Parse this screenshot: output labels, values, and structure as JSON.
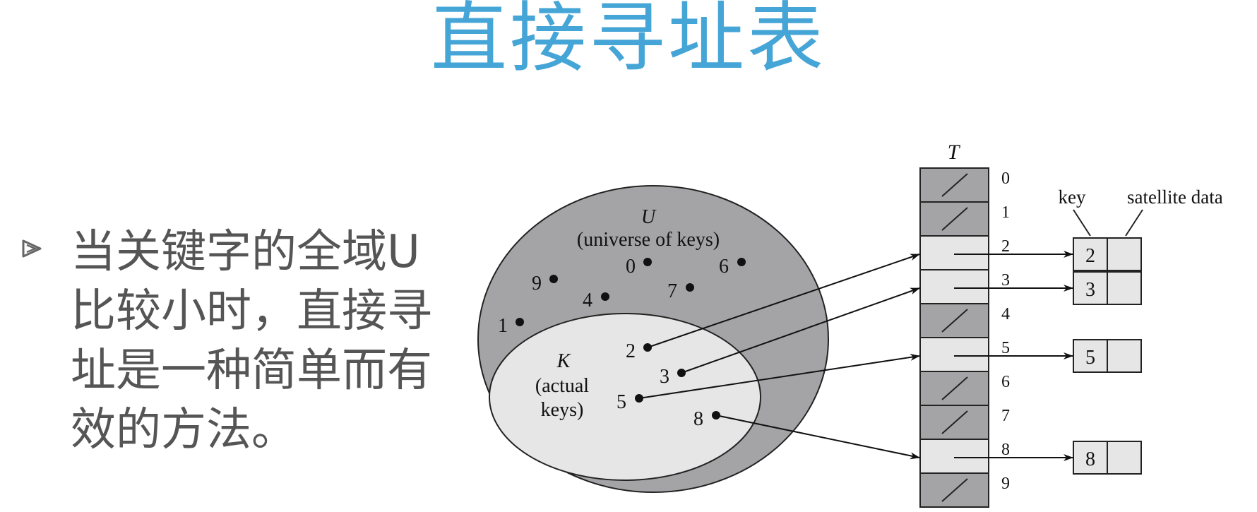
{
  "slide": {
    "title": "直接寻址表",
    "bullet_text": "当关键字的全域U比较小时，直接寻址是一种简单而有效的方法。"
  },
  "colors": {
    "title": "#45a5d6",
    "universe_fill": "#a4a4a6",
    "actual_keys_fill": "#e6e6e6",
    "empty_slot_fill": "#a4a4a6",
    "filled_slot_fill": "#e6e6e6",
    "bullet_text": "#555555"
  },
  "diagram": {
    "universe": {
      "symbol": "U",
      "caption": "(universe of keys)",
      "keys": [
        "0",
        "6",
        "9",
        "7",
        "4",
        "1"
      ]
    },
    "actual_keys": {
      "symbol": "K",
      "caption_line1": "(actual",
      "caption_line2": "keys)",
      "keys": [
        "2",
        "3",
        "5",
        "8"
      ]
    },
    "table": {
      "name": "T",
      "slot_indices": [
        "0",
        "1",
        "2",
        "3",
        "4",
        "5",
        "6",
        "7",
        "8",
        "9"
      ],
      "occupied_slots": [
        2,
        3,
        5,
        8
      ]
    },
    "records": {
      "key_label": "key",
      "satellite_label": "satellite data",
      "keys": [
        "2",
        "3",
        "5",
        "8"
      ]
    }
  }
}
